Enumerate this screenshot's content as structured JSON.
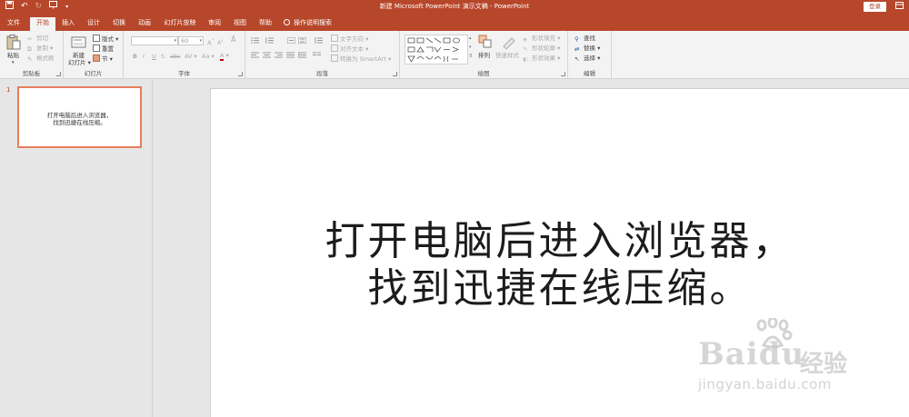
{
  "window": {
    "title": "新建 Microsoft PowerPoint 演示文稿 - PowerPoint",
    "login_label": "登录"
  },
  "tabs": [
    {
      "label": "文件"
    },
    {
      "label": "开始"
    },
    {
      "label": "插入"
    },
    {
      "label": "设计"
    },
    {
      "label": "切换"
    },
    {
      "label": "动画"
    },
    {
      "label": "幻灯片放映"
    },
    {
      "label": "审阅"
    },
    {
      "label": "视图"
    },
    {
      "label": "帮助"
    },
    {
      "label": "操作说明搜索"
    }
  ],
  "ribbon": {
    "clipboard": {
      "label": "剪贴板",
      "paste": "粘贴",
      "cut": "剪切",
      "copy": "复制",
      "format_painter": "格式刷"
    },
    "slides": {
      "label": "幻灯片",
      "new_slide_1": "新建",
      "new_slide_2": "幻灯片",
      "layout": "版式",
      "reset": "重置",
      "section": "节"
    },
    "font": {
      "label": "字体",
      "font_size": "60"
    },
    "paragraph": {
      "label": "段落",
      "text_direction": "文字方向",
      "align_text": "对齐文本",
      "convert_smartart": "转换为 SmartArt"
    },
    "drawing": {
      "label": "绘图",
      "arrange": "排列",
      "quick_styles": "快速样式",
      "shape_fill": "形状填充",
      "shape_outline": "形状轮廓",
      "shape_effects": "形状效果"
    },
    "editing": {
      "label": "编辑",
      "find": "查找",
      "replace": "替换",
      "select": "选择"
    }
  },
  "thumbnails": [
    {
      "number": "1",
      "line1": "打开电脑后进入浏览器，",
      "line2": "找到迅捷在线压缩。"
    }
  ],
  "slide": {
    "line1": "打开电脑后进入浏览器，",
    "line2": "找到迅捷在线压缩。"
  },
  "watermark": {
    "logo": "Bai",
    "logo2": "du",
    "cn": "经验",
    "url": "jingyan.baidu.com"
  },
  "colors": {
    "accent": "#b7472a",
    "ribbon_bg": "#f3f3f3",
    "thumb_border": "#e97d5e"
  }
}
